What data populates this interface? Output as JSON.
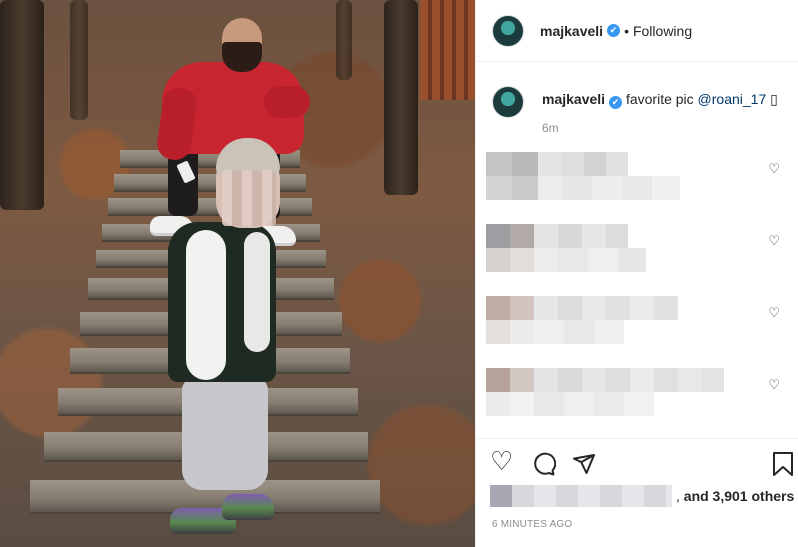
{
  "post": {
    "username": "majkaveli",
    "verified_mark": "✔",
    "separator": "•",
    "follow_status": "Following",
    "caption": {
      "username": "majkaveli",
      "text": "favorite pic",
      "mention": "@roani_17",
      "emoji": "▯",
      "time": "6m"
    },
    "comments": [
      {
        "heart_icon": "♡"
      },
      {
        "heart_icon": "♡"
      },
      {
        "heart_icon": "♡"
      },
      {
        "heart_icon": "♡"
      }
    ],
    "actions": {
      "like_icon": "♡",
      "comment_icon": "◯",
      "share_icon": "➢",
      "save_icon": "bookmark-icon"
    },
    "likes": {
      "prefix": ",",
      "text": "and 3,901 others"
    },
    "timestamp": "6 MINUTES AGO"
  },
  "colors": {
    "verified": "#3897f0",
    "mention": "#00376b",
    "muted": "#8e8e8e"
  }
}
